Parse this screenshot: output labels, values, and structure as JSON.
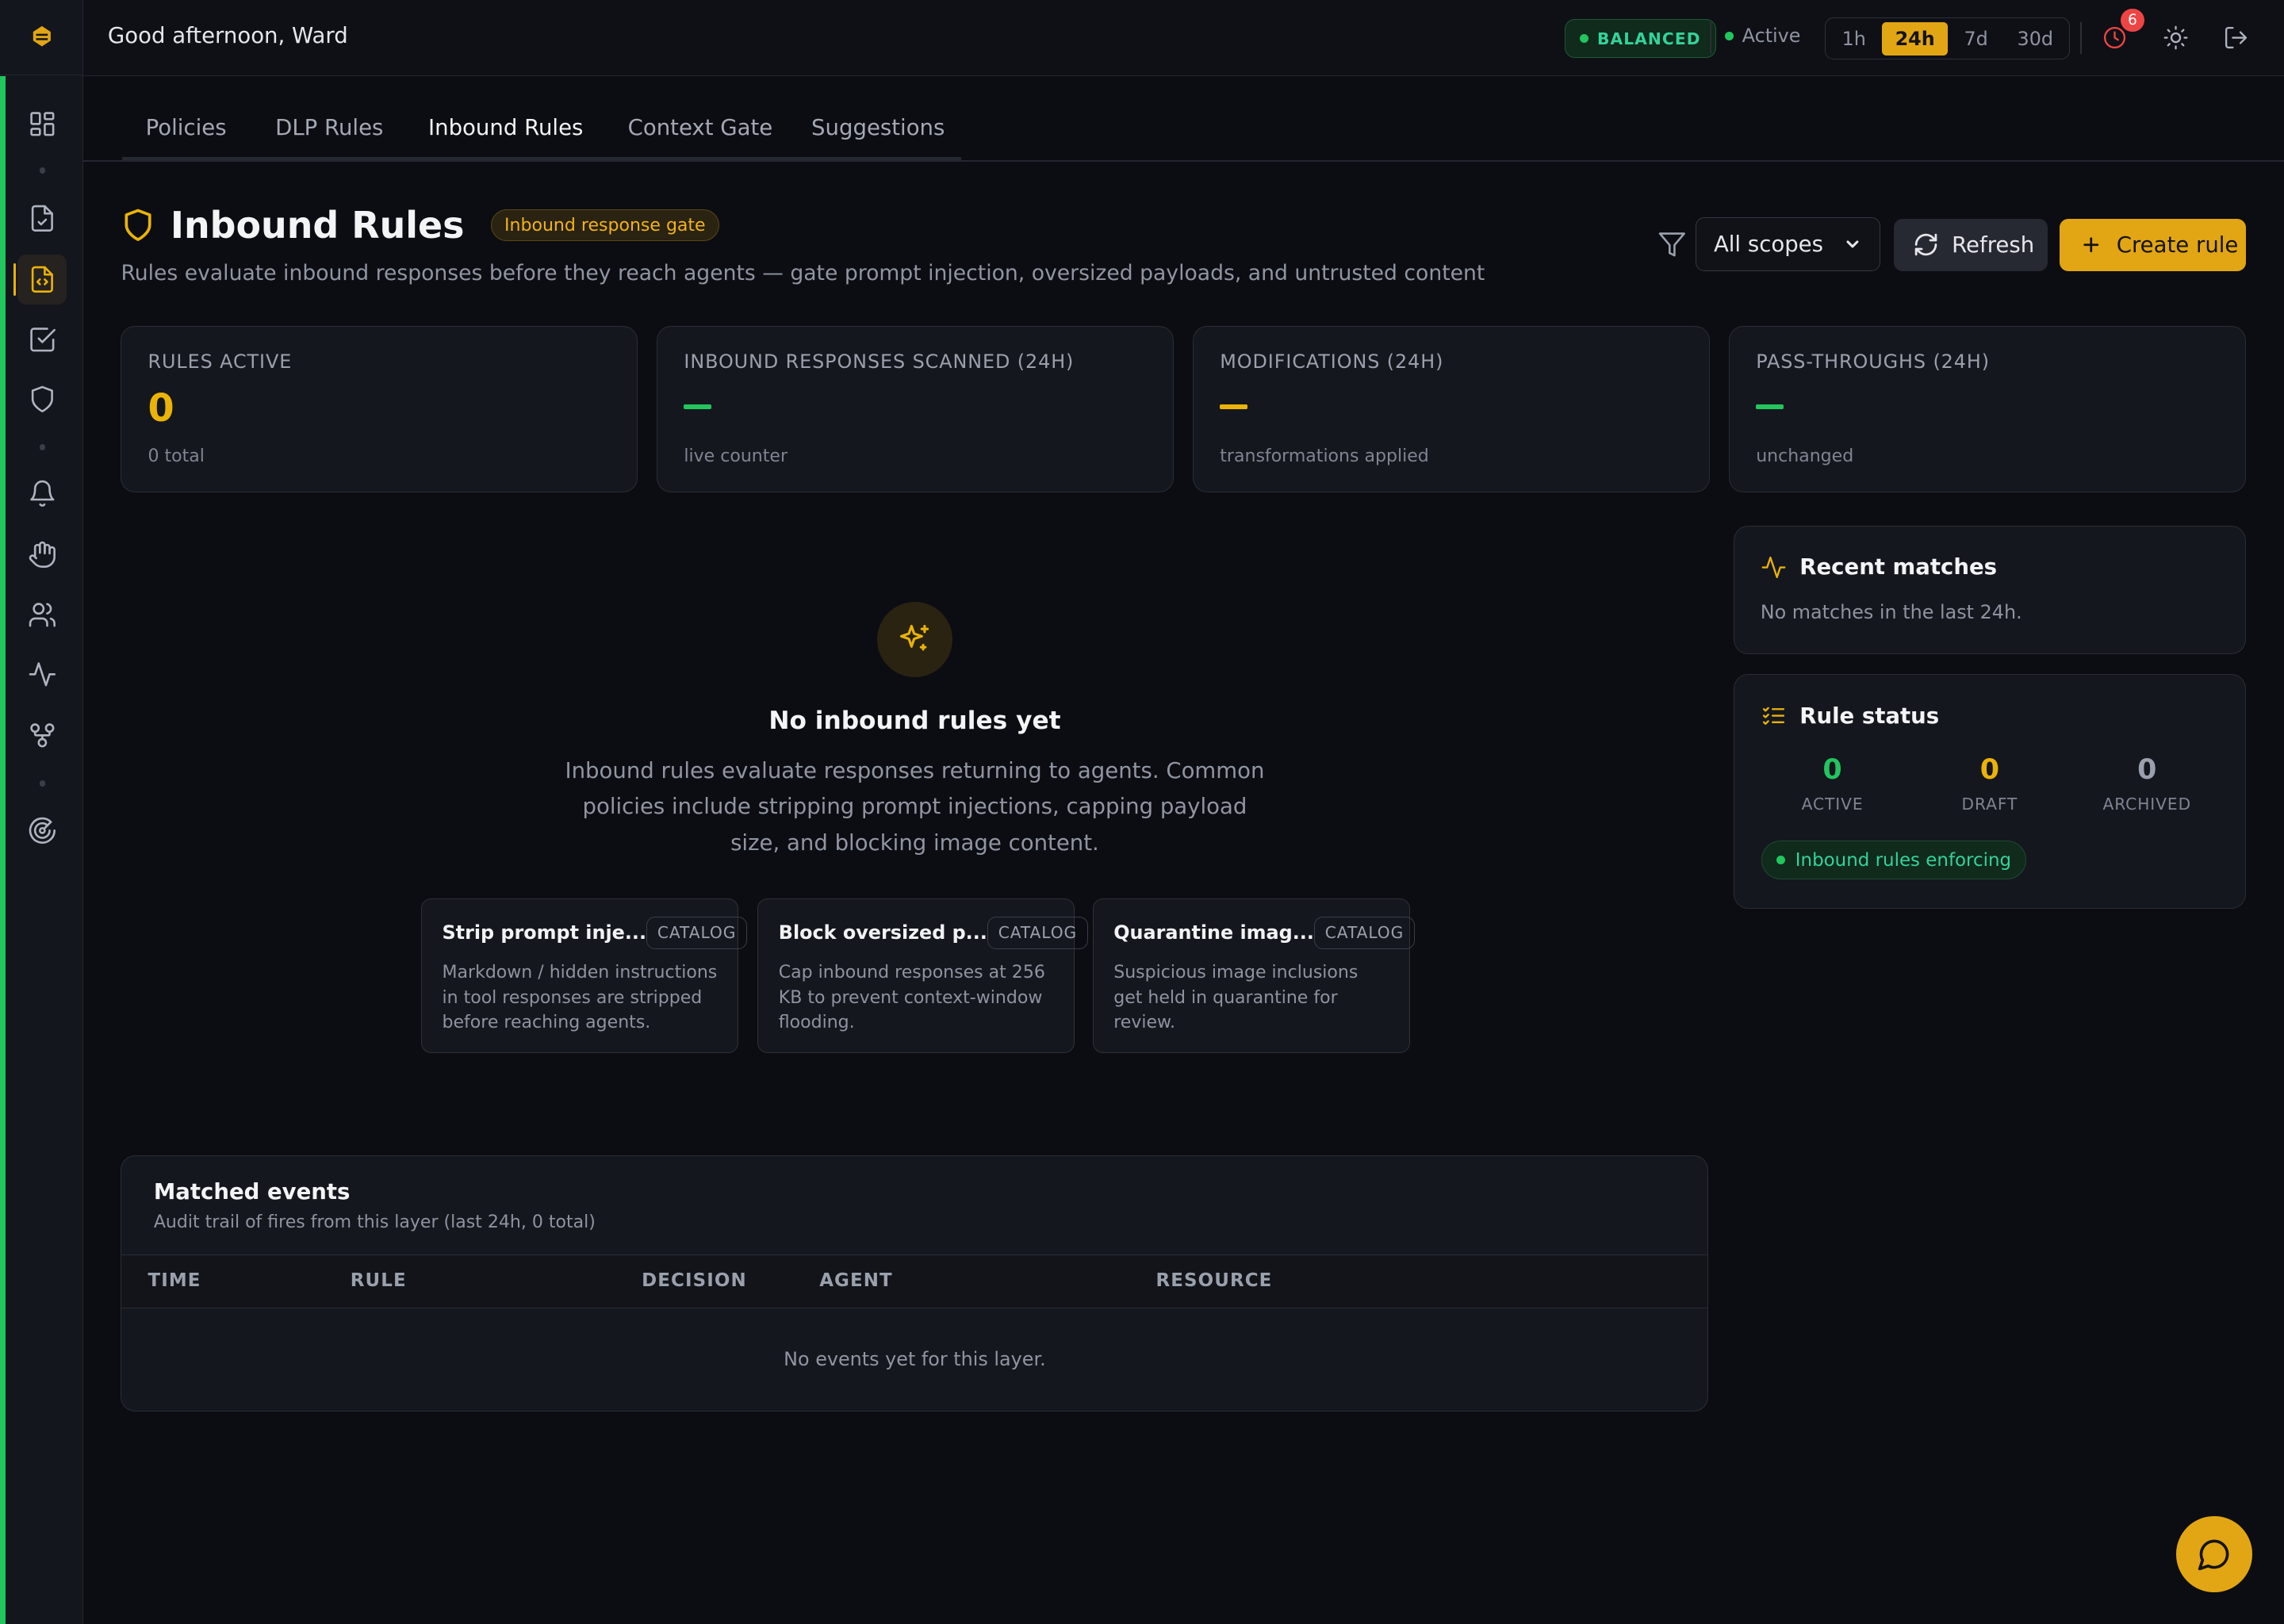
{
  "header": {
    "greeting": "Good afternoon, Ward",
    "mode": "BALANCED",
    "status": "Active",
    "time_ranges": [
      "1h",
      "24h",
      "7d",
      "30d"
    ],
    "selected_range": "24h",
    "notification_count": "6"
  },
  "tabs": [
    {
      "label": "Policies"
    },
    {
      "label": "DLP Rules"
    },
    {
      "label": "Inbound Rules"
    },
    {
      "label": "Context Gate"
    },
    {
      "label": "Suggestions"
    }
  ],
  "page": {
    "title": "Inbound Rules",
    "badge": "Inbound response gate",
    "subtitle": "Rules evaluate inbound responses before they reach agents — gate prompt injection, oversized payloads, and untrusted content",
    "scope_selected": "All scopes",
    "refresh_label": "Refresh",
    "create_label": "Create rule"
  },
  "stats": [
    {
      "label": "Rules active",
      "value": "0",
      "sub": "0 total"
    },
    {
      "label": "Inbound responses scanned (24h)",
      "value": "",
      "sub": "live counter"
    },
    {
      "label": "Modifications (24h)",
      "value": "",
      "sub": "transformations applied"
    },
    {
      "label": "Pass-throughs (24h)",
      "value": "",
      "sub": "unchanged"
    }
  ],
  "empty_state": {
    "title": "No inbound rules yet",
    "description": "Inbound rules evaluate responses returning to agents. Common policies include stripping prompt injections, capping payload size, and blocking image content."
  },
  "catalog": [
    {
      "name": "Strip prompt inje...",
      "tag": "CATALOG",
      "desc": "Markdown / hidden instructions in tool responses are stripped before reaching agents."
    },
    {
      "name": "Block oversized p...",
      "tag": "CATALOG",
      "desc": "Cap inbound responses at 256 KB to prevent context-window flooding."
    },
    {
      "name": "Quarantine imag...",
      "tag": "CATALOG",
      "desc": "Suspicious image inclusions get held in quarantine for review."
    }
  ],
  "recent_matches": {
    "title": "Recent matches",
    "message": "No matches in the last 24h."
  },
  "rule_status": {
    "title": "Rule status",
    "items": [
      {
        "value": "0",
        "label": "ACTIVE",
        "color": "#22c55e"
      },
      {
        "value": "0",
        "label": "DRAFT",
        "color": "#eab308"
      },
      {
        "value": "0",
        "label": "ARCHIVED",
        "color": "#9aa0ac"
      }
    ],
    "enforcing_label": "Inbound rules enforcing"
  },
  "events": {
    "title": "Matched events",
    "subtitle": "Audit trail of fires from this layer (last 24h, 0 total)",
    "columns": [
      "TIME",
      "RULE",
      "DECISION",
      "AGENT",
      "RESOURCE"
    ],
    "empty": "No events yet for this layer."
  },
  "colors": {
    "accent": "#e2a614",
    "success": "#22c55e",
    "danger": "#ef4444"
  },
  "icons": {
    "sidebar": [
      "dashboard-icon",
      "file-check-icon",
      "file-code-icon",
      "check-square-icon",
      "shield-icon",
      "bell-icon",
      "hand-icon",
      "users-icon",
      "activity-icon",
      "git-fork-icon",
      "radar-icon"
    ],
    "topbar": [
      "clock-alert-icon",
      "sun-icon",
      "logout-icon"
    ]
  }
}
